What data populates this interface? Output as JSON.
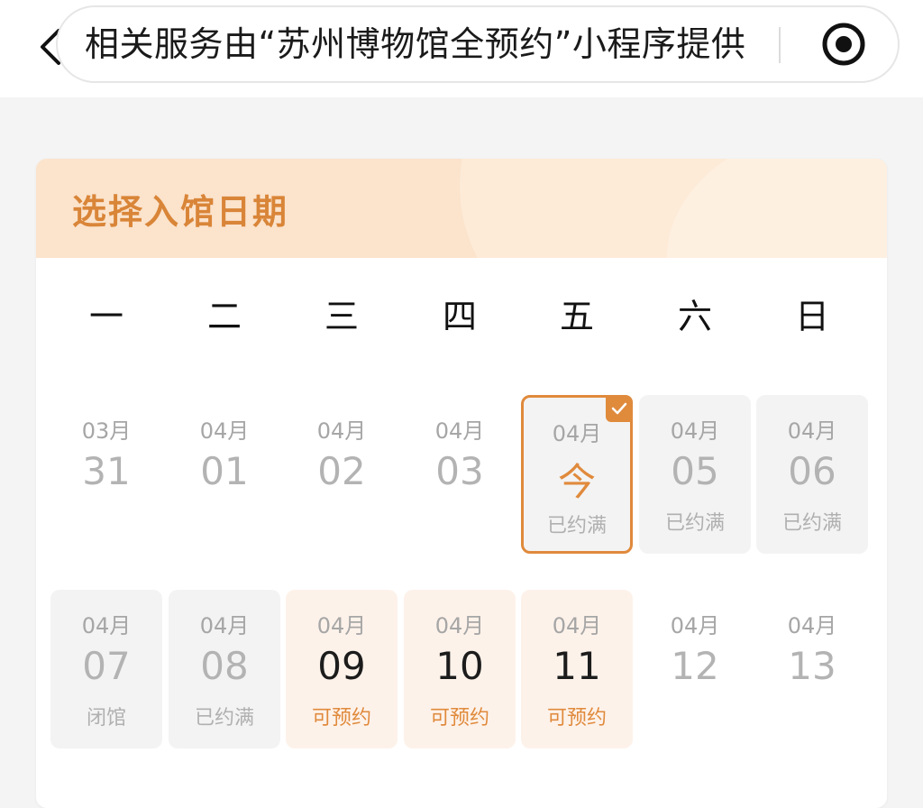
{
  "header": {
    "title": "相关服务由“苏州博物馆全预约”小程序提供",
    "back_icon": "chevron-left-icon",
    "record_icon": "record-icon"
  },
  "card": {
    "title": "选择入馆日期",
    "weekdays": [
      "一",
      "二",
      "三",
      "四",
      "五",
      "六",
      "日"
    ]
  },
  "colors": {
    "accent": "#e08a3c",
    "title": "#d98538",
    "header_bg": "#fbe3cc",
    "available_bg": "#fdf2ea",
    "full_bg": "#f3f3f3"
  },
  "calendar": {
    "days": [
      {
        "month": "03月",
        "day": "31",
        "status": ""
      },
      {
        "month": "04月",
        "day": "01",
        "status": ""
      },
      {
        "month": "04月",
        "day": "02",
        "status": ""
      },
      {
        "month": "04月",
        "day": "03",
        "status": ""
      },
      {
        "month": "04月",
        "day": "今",
        "status": "已约满"
      },
      {
        "month": "04月",
        "day": "05",
        "status": "已约满"
      },
      {
        "month": "04月",
        "day": "06",
        "status": "已约满"
      },
      {
        "month": "04月",
        "day": "07",
        "status": "闭馆"
      },
      {
        "month": "04月",
        "day": "08",
        "status": "已约满"
      },
      {
        "month": "04月",
        "day": "09",
        "status": "可预约"
      },
      {
        "month": "04月",
        "day": "10",
        "status": "可预约"
      },
      {
        "month": "04月",
        "day": "11",
        "status": "可预约"
      },
      {
        "month": "04月",
        "day": "12",
        "status": ""
      },
      {
        "month": "04月",
        "day": "13",
        "status": ""
      }
    ]
  }
}
